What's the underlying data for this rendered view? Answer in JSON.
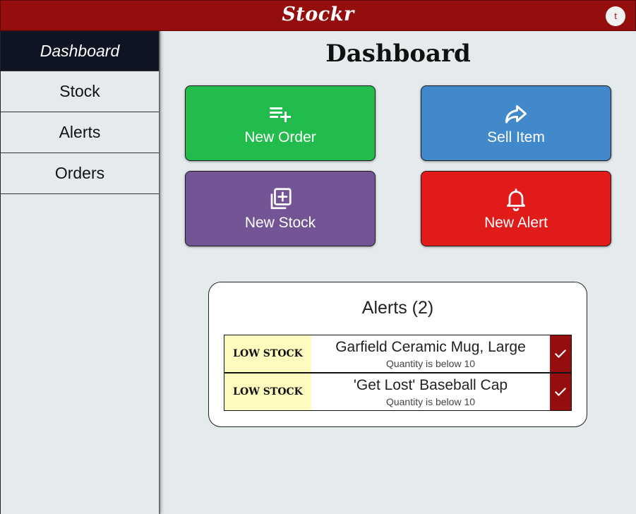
{
  "app": {
    "brand": "Stockr",
    "user_initial": "t"
  },
  "sidebar": {
    "items": [
      {
        "label": "Dashboard"
      },
      {
        "label": "Stock"
      },
      {
        "label": "Alerts"
      },
      {
        "label": "Orders"
      }
    ]
  },
  "main": {
    "title": "Dashboard",
    "actions": {
      "new_order": {
        "label": "New Order",
        "icon": "playlist-add-icon",
        "color": "#22bc4c"
      },
      "sell_item": {
        "label": "Sell Item",
        "icon": "share-arrow-icon",
        "color": "#4189cb"
      },
      "new_stock": {
        "label": "New Stock",
        "icon": "add-box-icon",
        "color": "#735596"
      },
      "new_alert": {
        "label": "New Alert",
        "icon": "bell-icon",
        "color": "#e11a1a"
      }
    }
  },
  "alerts": {
    "title": "Alerts (2)",
    "items": [
      {
        "badge": "LOW STOCK",
        "name": "Garfield Ceramic Mug, Large",
        "detail": "Quantity is below 10"
      },
      {
        "badge": "LOW STOCK",
        "name": "'Get Lost' Baseball Cap",
        "detail": "Quantity is below 10"
      }
    ]
  },
  "colors": {
    "topbar": "#950e0e",
    "sidebar_active": "#0e1424",
    "background": "#e5eaed",
    "badge_bg": "#fffbbf"
  }
}
